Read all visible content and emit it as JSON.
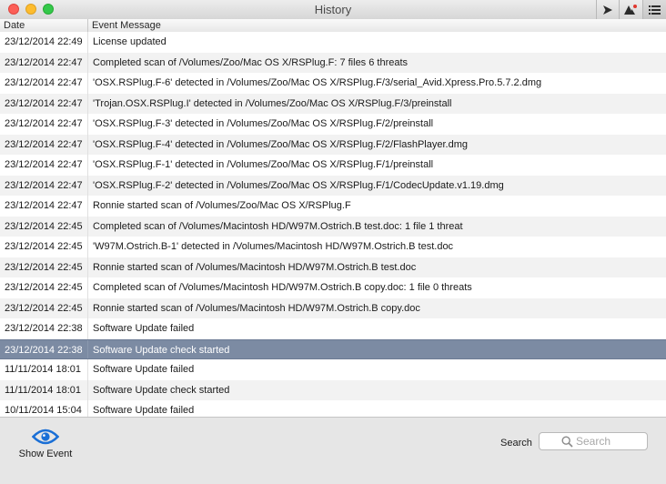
{
  "window": {
    "title": "History"
  },
  "columns": {
    "date": "Date",
    "message": "Event Message"
  },
  "rows": [
    {
      "date": "23/12/2014 22:49",
      "message": "License updated"
    },
    {
      "date": "23/12/2014 22:47",
      "message": "Completed scan of /Volumes/Zoo/Mac OS X/RSPlug.F: 7 files 6 threats"
    },
    {
      "date": "23/12/2014 22:47",
      "message": "'OSX.RSPlug.F-6' detected in /Volumes/Zoo/Mac OS X/RSPlug.F/3/serial_Avid.Xpress.Pro.5.7.2.dmg"
    },
    {
      "date": "23/12/2014 22:47",
      "message": "'Trojan.OSX.RSPlug.I' detected in /Volumes/Zoo/Mac OS X/RSPlug.F/3/preinstall"
    },
    {
      "date": "23/12/2014 22:47",
      "message": "'OSX.RSPlug.F-3' detected in /Volumes/Zoo/Mac OS X/RSPlug.F/2/preinstall"
    },
    {
      "date": "23/12/2014 22:47",
      "message": "'OSX.RSPlug.F-4' detected in /Volumes/Zoo/Mac OS X/RSPlug.F/2/FlashPlayer.dmg"
    },
    {
      "date": "23/12/2014 22:47",
      "message": "'OSX.RSPlug.F-1' detected in /Volumes/Zoo/Mac OS X/RSPlug.F/1/preinstall"
    },
    {
      "date": "23/12/2014 22:47",
      "message": "'OSX.RSPlug.F-2' detected in /Volumes/Zoo/Mac OS X/RSPlug.F/1/CodecUpdate.v1.19.dmg"
    },
    {
      "date": "23/12/2014 22:47",
      "message": "Ronnie started scan of /Volumes/Zoo/Mac OS X/RSPlug.F"
    },
    {
      "date": "23/12/2014 22:45",
      "message": "Completed scan of /Volumes/Macintosh HD/W97M.Ostrich.B test.doc: 1 file 1 threat"
    },
    {
      "date": "23/12/2014 22:45",
      "message": "'W97M.Ostrich.B-1' detected in /Volumes/Macintosh HD/W97M.Ostrich.B test.doc"
    },
    {
      "date": "23/12/2014 22:45",
      "message": "Ronnie started scan of /Volumes/Macintosh HD/W97M.Ostrich.B test.doc"
    },
    {
      "date": "23/12/2014 22:45",
      "message": "Completed scan of /Volumes/Macintosh HD/W97M.Ostrich.B copy.doc: 1 file 0 threats"
    },
    {
      "date": "23/12/2014 22:45",
      "message": "Ronnie started scan of /Volumes/Macintosh HD/W97M.Ostrich.B copy.doc"
    },
    {
      "date": "23/12/2014 22:38",
      "message": "Software Update failed"
    },
    {
      "date": "23/12/2014 22:38",
      "message": "Software Update check started"
    },
    {
      "date": "11/11/2014 18:01",
      "message": "Software Update failed"
    },
    {
      "date": "11/11/2014 18:01",
      "message": "Software Update check started"
    },
    {
      "date": "10/11/2014 15:04",
      "message": "Software Update failed"
    }
  ],
  "selected_row": 15,
  "toolbar": {
    "play_icon": "play-arrow-icon",
    "alert_icon": "alert-triangle-icon",
    "list_icon": "list-icon"
  },
  "bottom": {
    "show_event_label": "Show Event",
    "search_label": "Search",
    "search_placeholder": "Search",
    "search_value": ""
  },
  "colors": {
    "selection": "#7c8ba3",
    "accent_blue": "#1a6fd6",
    "close": "#fc5f57",
    "minimize": "#fdbc2e",
    "zoom": "#34c84a",
    "alert_dot": "#e0382f"
  }
}
